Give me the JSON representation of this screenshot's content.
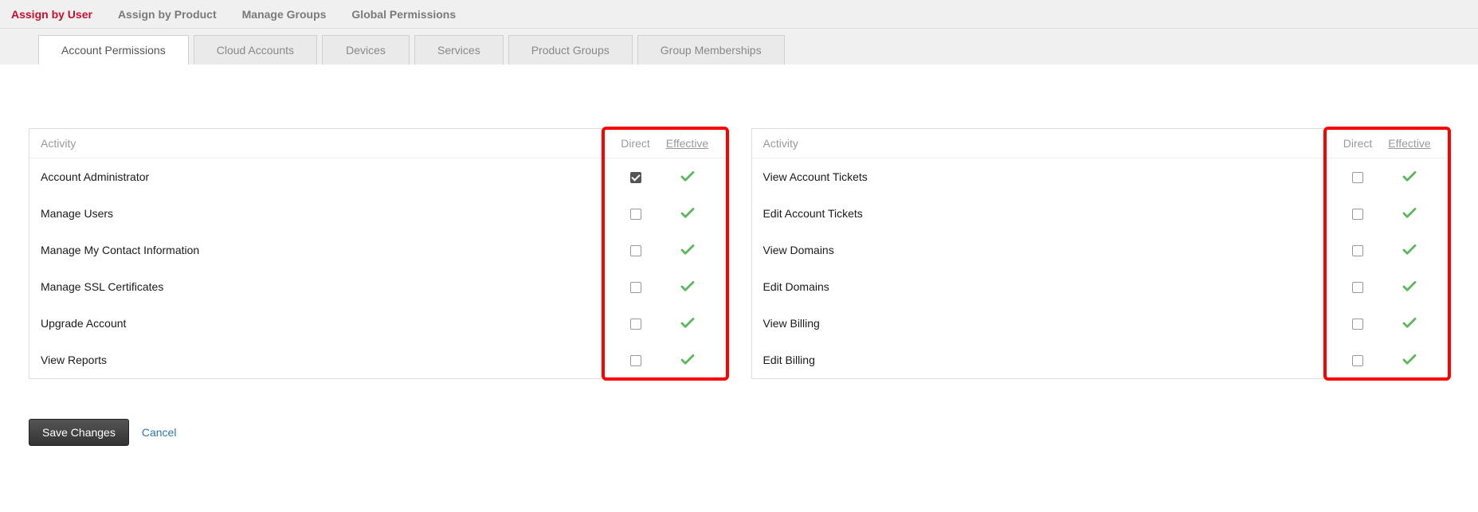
{
  "topNav": {
    "items": [
      {
        "label": "Assign by User",
        "active": true
      },
      {
        "label": "Assign by Product",
        "active": false
      },
      {
        "label": "Manage Groups",
        "active": false
      },
      {
        "label": "Global Permissions",
        "active": false
      }
    ]
  },
  "subTabs": {
    "items": [
      {
        "label": "Account Permissions",
        "active": true
      },
      {
        "label": "Cloud Accounts",
        "active": false
      },
      {
        "label": "Devices",
        "active": false
      },
      {
        "label": "Services",
        "active": false
      },
      {
        "label": "Product Groups",
        "active": false
      },
      {
        "label": "Group Memberships",
        "active": false
      }
    ]
  },
  "headers": {
    "activity": "Activity",
    "direct": "Direct",
    "effective": "Effective"
  },
  "leftPanel": {
    "rows": [
      {
        "activity": "Account Administrator",
        "direct": true,
        "effective": true
      },
      {
        "activity": "Manage Users",
        "direct": false,
        "effective": true
      },
      {
        "activity": "Manage My Contact Information",
        "direct": false,
        "effective": true
      },
      {
        "activity": "Manage SSL Certificates",
        "direct": false,
        "effective": true
      },
      {
        "activity": "Upgrade Account",
        "direct": false,
        "effective": true
      },
      {
        "activity": "View Reports",
        "direct": false,
        "effective": true
      }
    ]
  },
  "rightPanel": {
    "rows": [
      {
        "activity": "View Account Tickets",
        "direct": false,
        "effective": true
      },
      {
        "activity": "Edit Account Tickets",
        "direct": false,
        "effective": true
      },
      {
        "activity": "View Domains",
        "direct": false,
        "effective": true
      },
      {
        "activity": "Edit Domains",
        "direct": false,
        "effective": true
      },
      {
        "activity": "View Billing",
        "direct": false,
        "effective": true
      },
      {
        "activity": "Edit Billing",
        "direct": false,
        "effective": true
      }
    ]
  },
  "actions": {
    "save": "Save Changes",
    "cancel": "Cancel"
  },
  "colors": {
    "accent": "#c8102e",
    "check": "#5cb85c",
    "highlight": "#ff0000"
  }
}
